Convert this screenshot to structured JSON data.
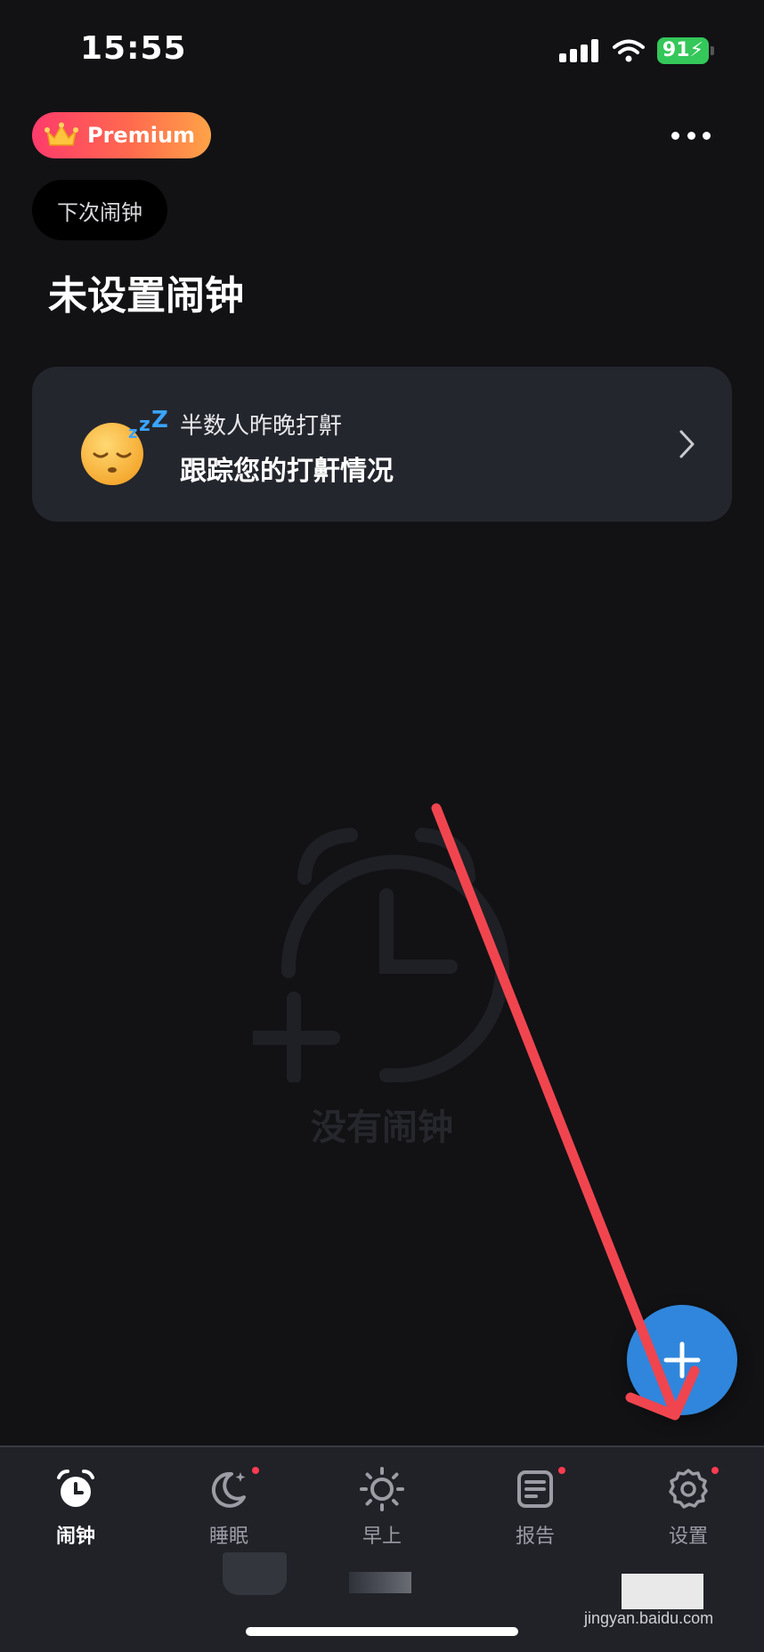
{
  "status_bar": {
    "time": "15:55",
    "battery": "91"
  },
  "header": {
    "premium_label": "Premium"
  },
  "next_alarm_chip": "下次闹钟",
  "title": "未设置闹钟",
  "snore_card": {
    "subtitle": "半数人昨晚打鼾",
    "headline": "跟踪您的打鼾情况"
  },
  "empty_state": {
    "text": "没有闹钟"
  },
  "tabs": [
    {
      "label": "闹钟",
      "icon": "alarm-clock-icon",
      "active": true,
      "badge": false
    },
    {
      "label": "睡眠",
      "icon": "moon-icon",
      "active": false,
      "badge": true
    },
    {
      "label": "早上",
      "icon": "sun-icon",
      "active": false,
      "badge": false
    },
    {
      "label": "报告",
      "icon": "report-icon",
      "active": false,
      "badge": true
    },
    {
      "label": "设置",
      "icon": "gear-icon",
      "active": false,
      "badge": true
    }
  ],
  "watermark": {
    "text": "jingyan.baidu.com"
  },
  "colors": {
    "background": "#121215",
    "card": "#24262d",
    "fab": "#2f86dc",
    "badge": "#ff3b50",
    "arrow": "#f0454f",
    "premium_gradient": [
      "#ff3b6b",
      "#ffa347"
    ]
  }
}
